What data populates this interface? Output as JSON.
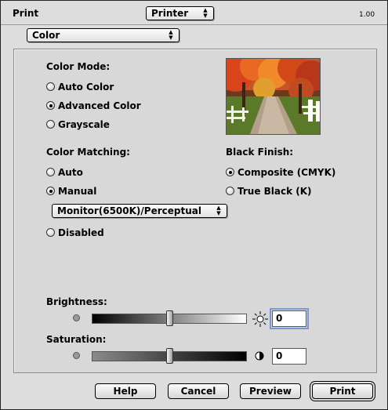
{
  "header": {
    "title": "Print",
    "printer_popup": "Printer",
    "version": "1.00"
  },
  "panel_popup": "Color",
  "color_mode": {
    "label": "Color Mode:",
    "options": [
      "Auto Color",
      "Advanced Color",
      "Grayscale"
    ],
    "selected": "Advanced Color"
  },
  "color_matching": {
    "label": "Color Matching:",
    "options": [
      "Auto",
      "Manual",
      "Disabled"
    ],
    "selected": "Manual",
    "profile_popup": "Monitor(6500K)/Perceptual"
  },
  "black_finish": {
    "label": "Black Finish:",
    "options": [
      "Composite (CMYK)",
      "True Black (K)"
    ],
    "selected": "Composite (CMYK)"
  },
  "brightness": {
    "label": "Brightness:",
    "value": "0",
    "level": 0.5
  },
  "saturation": {
    "label": "Saturation:",
    "value": "0",
    "level": 0.5
  },
  "buttons": {
    "help": "Help",
    "cancel": "Cancel",
    "preview": "Preview",
    "print": "Print"
  },
  "icons": {
    "sun": "sun-icon",
    "half_circle": "contrast-icon",
    "dimmer": "small-dot-icon"
  },
  "colors": {
    "focus_ring": "#7a9ad6",
    "background": "#dddddd"
  }
}
